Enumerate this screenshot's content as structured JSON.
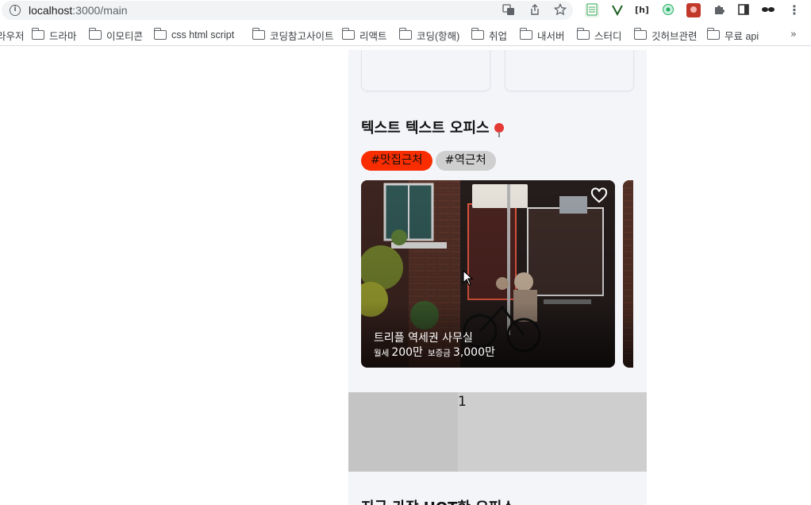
{
  "browser": {
    "url_host": "localhost",
    "url_rest": ":3000/main",
    "omnibox_icons": [
      "translate-icon",
      "share-icon",
      "star-icon"
    ],
    "extension_icons": [
      "sheets-extension-icon",
      "vector-extension-icon",
      "hackernews-extension-icon",
      "wheel-extension-icon",
      "red-extension-icon",
      "puzzle-extensions-icon",
      "sidepanel-icon",
      "eyes-extension-icon",
      "kebab-menu-icon"
    ],
    "bookmarks": [
      {
        "label": "라우저",
        "folder": false
      },
      {
        "label": "드라마",
        "folder": true
      },
      {
        "label": "이모티콘",
        "folder": true
      },
      {
        "label": "css html script",
        "folder": true
      },
      {
        "label": "코딩참고사이트",
        "folder": true
      },
      {
        "label": "리액트",
        "folder": true
      },
      {
        "label": "코딩(항해)",
        "folder": true
      },
      {
        "label": "취업",
        "folder": true
      },
      {
        "label": "내서버",
        "folder": true
      },
      {
        "label": "스터디",
        "folder": true
      },
      {
        "label": "깃허브관련",
        "folder": true
      },
      {
        "label": "무료 api",
        "folder": true
      }
    ],
    "bookmarks_more": "»"
  },
  "section": {
    "title": "텍스트 텍스트 오피스",
    "tags": [
      {
        "label": "#맛집근처",
        "active": true
      },
      {
        "label": "#역근처",
        "active": false
      }
    ],
    "cards": [
      {
        "title": "트리플 역세권 사무실",
        "price": [
          {
            "label": "월세",
            "value": "200만"
          },
          {
            "label": "보증금",
            "value": "3,000만"
          }
        ],
        "liked": false
      }
    ]
  },
  "banner": {
    "page": "1"
  },
  "next_section": {
    "title": "지금 가장 HOT한 오피스"
  },
  "colors": {
    "accent_tag": "#fa2d00",
    "inactive_tag": "#cfcfcf",
    "column_bg": "#f4f5f9",
    "banner_bg": "#cecece"
  }
}
